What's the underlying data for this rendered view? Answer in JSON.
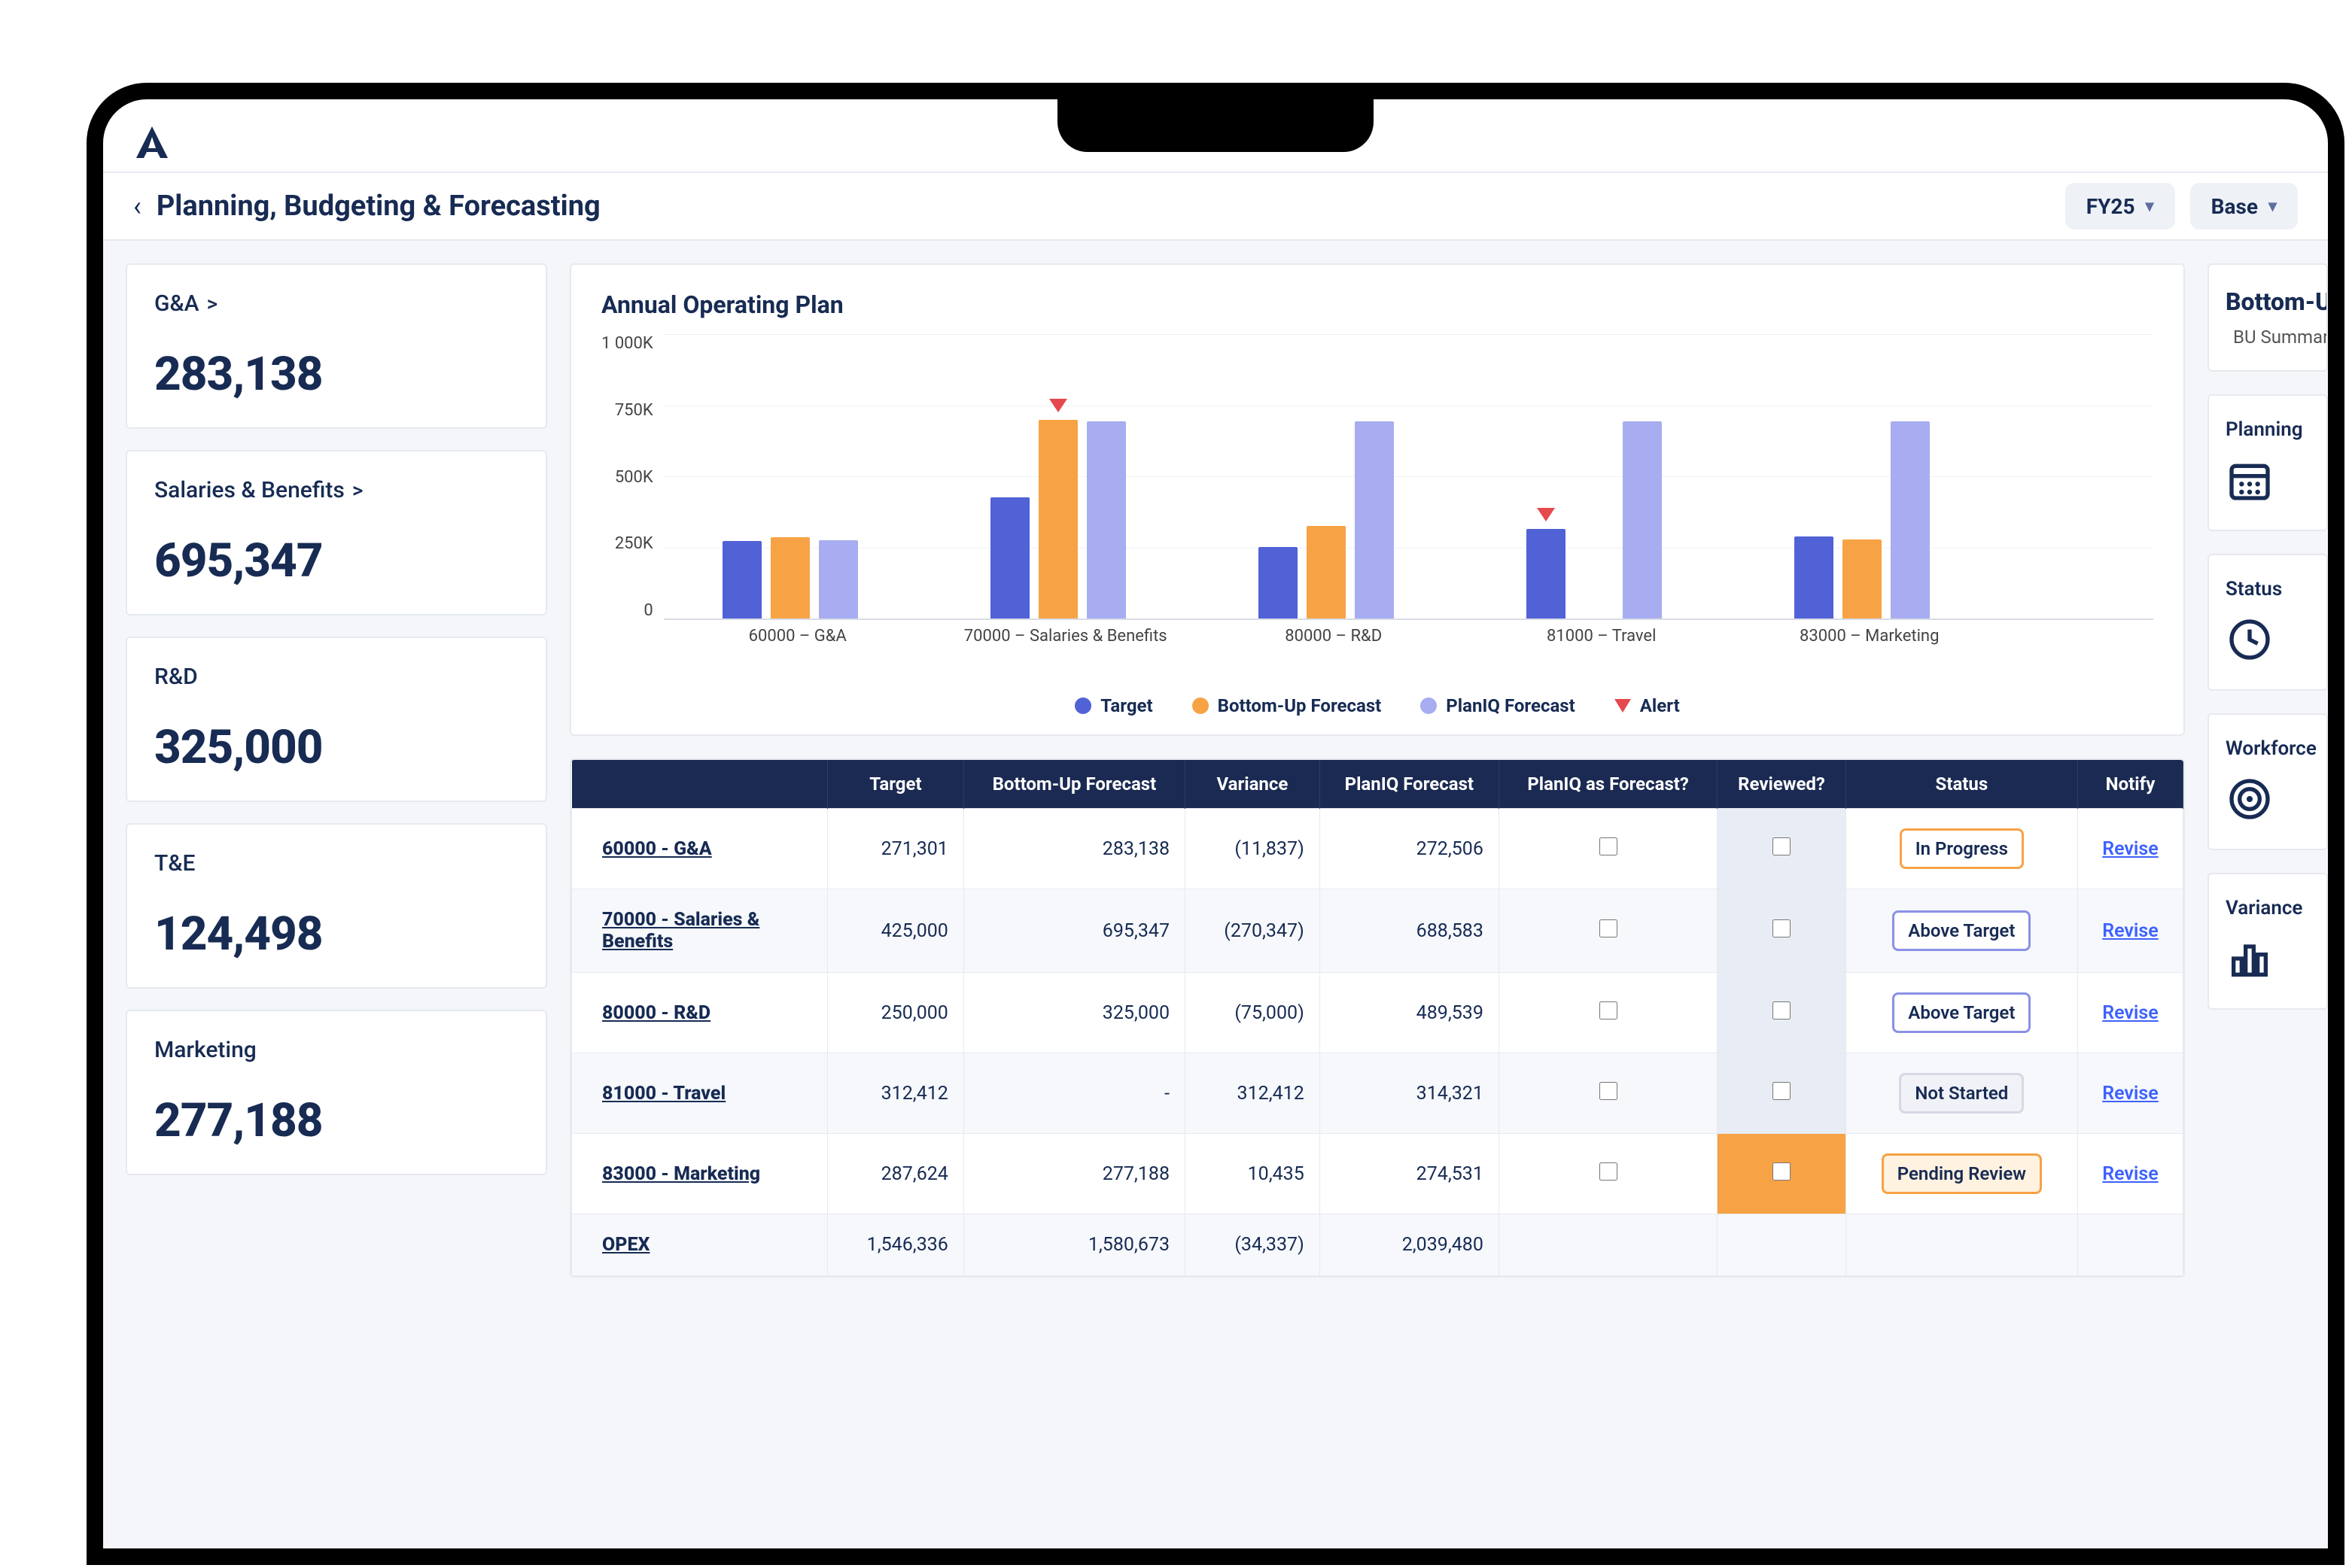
{
  "header": {
    "breadcrumb_title": "Planning, Budgeting & Forecasting",
    "fy_pill": "FY25",
    "base_pill": "Base"
  },
  "stats": [
    {
      "label": "G&A",
      "value": "283,138",
      "caret": ">"
    },
    {
      "label": "Salaries & Benefits",
      "value": "695,347",
      "caret": ">"
    },
    {
      "label": "R&D",
      "value": "325,000",
      "caret": ""
    },
    {
      "label": "T&E",
      "value": "124,498",
      "caret": ""
    },
    {
      "label": "Marketing",
      "value": "277,188",
      "caret": ""
    }
  ],
  "chart": {
    "title": "Annual Operating Plan",
    "y_ticks": [
      "1 000K",
      "750K",
      "500K",
      "250K",
      "0"
    ],
    "legend": {
      "target": "Target",
      "bottomup": "Bottom-Up Forecast",
      "planiq": "PlanIQ Forecast",
      "alert": "Alert"
    },
    "categories": {
      "0": "60000 – G&A",
      "1": "70000 – Salaries & Benefits",
      "2": "80000 – R&D",
      "3": "81000 – Travel",
      "4": "83000 – Marketing"
    }
  },
  "chart_data": {
    "type": "bar",
    "ylim": [
      0,
      1000000
    ],
    "categories": [
      "60000 – G&A",
      "70000 – Salaries & Benefits",
      "80000 – R&D",
      "81000 – Travel",
      "83000 – Marketing"
    ],
    "series": [
      {
        "name": "Target",
        "values": [
          271301,
          425000,
          250000,
          312412,
          287624
        ]
      },
      {
        "name": "Bottom-Up Forecast",
        "values": [
          283138,
          695347,
          325000,
          null,
          277188
        ]
      },
      {
        "name": "PlanIQ Forecast",
        "values": [
          272506,
          688583,
          689539,
          689321,
          689531
        ]
      }
    ],
    "alerts": [
      {
        "category_index": 1,
        "series": "Bottom-Up Forecast"
      },
      {
        "category_index": 3,
        "series": "Target"
      }
    ]
  },
  "table": {
    "headers": {
      "c0": "",
      "c1": "Target",
      "c2": "Bottom-Up Forecast",
      "c3": "Variance",
      "c4": "PlanIQ Forecast",
      "c5": "PlanIQ as Forecast?",
      "c6": "Reviewed?",
      "c7": "Status",
      "c8": "Notify"
    },
    "rows": {
      "r0": {
        "acct": "60000 - G&A",
        "target": "271,301",
        "bu": "283,138",
        "var": "(11,837)",
        "piq": "272,506",
        "status": "In Progress",
        "notify": "Revise"
      },
      "r1": {
        "acct": "70000 - Salaries & Benefits",
        "target": "425,000",
        "bu": "695,347",
        "var": "(270,347)",
        "piq": "688,583",
        "status": "Above Target",
        "notify": "Revise"
      },
      "r2": {
        "acct": "80000 - R&D",
        "target": "250,000",
        "bu": "325,000",
        "var": "(75,000)",
        "piq": "489,539",
        "status": "Above Target",
        "notify": "Revise"
      },
      "r3": {
        "acct": "81000 - Travel",
        "target": "312,412",
        "bu": "-",
        "var": "312,412",
        "piq": "314,321",
        "status": "Not Started",
        "notify": "Revise"
      },
      "r4": {
        "acct": "83000 - Marketing",
        "target": "287,624",
        "bu": "277,188",
        "var": "10,435",
        "piq": "274,531",
        "status": "Pending Review",
        "notify": "Revise"
      },
      "total": {
        "acct": "OPEX",
        "target": "1,546,336",
        "bu": "1,580,673",
        "var": "(34,337)",
        "piq": "2,039,480"
      }
    }
  },
  "right": {
    "forecast_title": "Bottom-Up Forecast",
    "forecast_sub": "BU Summary",
    "planning_label": "Planning",
    "status_label": "Status",
    "workforce_label": "Workforce",
    "variance_label": "Variance"
  }
}
